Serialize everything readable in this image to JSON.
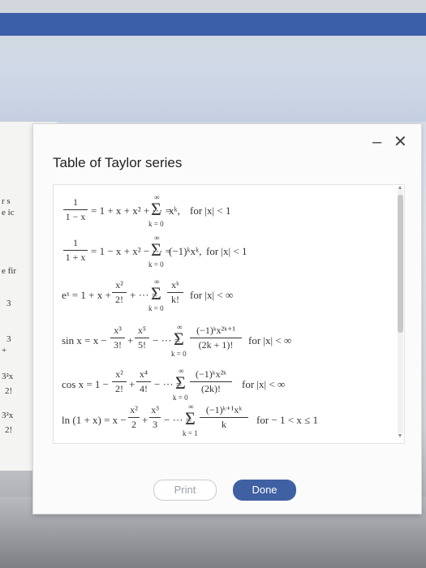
{
  "background": {
    "fragments": [
      "r s",
      "e ic",
      "e fir",
      "3",
      "3",
      "+",
      "3²x",
      "2!",
      "3²x",
      "2!"
    ]
  },
  "dialog": {
    "title": "Table of Taylor series",
    "minimize_label": "–",
    "close_label": "✕",
    "print_label": "Print",
    "done_label": "Done"
  },
  "series": [
    {
      "lhs_num": "1",
      "lhs_den": "1 − x",
      "expansion": "= 1 + x + x² + ··· =",
      "sigma_top": "∞",
      "sigma_bottom": "k = 0",
      "term": "xᵏ,",
      "condition": "for |x| < 1"
    },
    {
      "lhs_num": "1",
      "lhs_den": "1 + x",
      "expansion": "= 1 − x + x² − ··· =",
      "sigma_top": "∞",
      "sigma_bottom": "k = 0",
      "term": "(−1)ᵏxᵏ,",
      "condition": "for |x| < 1"
    },
    {
      "lhs": "eˣ = 1 + x +",
      "frac_num": "x²",
      "frac_den": "2!",
      "expansion": "+ ··· =",
      "sigma_top": "∞",
      "sigma_bottom": "k = 0",
      "term_num": "xᵏ",
      "term_den": "k!",
      "condition": "for |x| < ∞"
    },
    {
      "lhs": "sin x = x −",
      "frac_num": "x³",
      "frac_den": "3!",
      "frac2_num": "x⁵",
      "frac2_den": "5!",
      "expansion": "− ··· =",
      "sigma_top": "∞",
      "sigma_bottom": "k = 0",
      "term_num": "(−1)ᵏx²ᵏ⁺¹",
      "term_den": "(2k + 1)!",
      "condition": "for |x| < ∞"
    },
    {
      "lhs": "cos x = 1 −",
      "frac_num": "x²",
      "frac_den": "2!",
      "frac2_num": "x⁴",
      "frac2_den": "4!",
      "expansion": "− ··· =",
      "sigma_top": "∞",
      "sigma_bottom": "k = 0",
      "term_num": "(−1)ᵏx²ᵏ",
      "term_den": "(2k)!",
      "condition": "for |x| < ∞"
    },
    {
      "lhs": "ln (1 + x) = x −",
      "frac_num": "x²",
      "frac_den": "2",
      "frac2_num": "x³",
      "frac2_den": "3",
      "expansion": "− ··· =",
      "sigma_top": "∞",
      "sigma_bottom": "k = 1",
      "term_num": "(−1)ᵏ⁺¹xᵏ",
      "term_den": "k",
      "condition": "for − 1 < x ≤ 1"
    }
  ],
  "colors": {
    "accent": "#3f61a3",
    "window_bar": "#3b5fa8"
  }
}
